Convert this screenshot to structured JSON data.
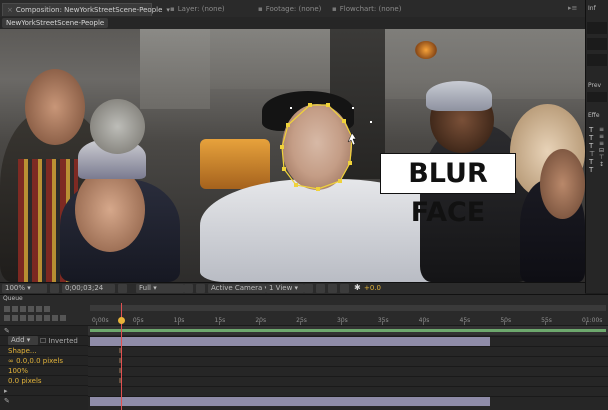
{
  "panels": {
    "composition_tab": "Composition: NewYorkStreetScene-People",
    "layer_tab": "Layer: (none)",
    "footage_tab": "Footage: (none)",
    "flowchart_tab": "Flowchart: (none)",
    "right_tab": "Inf"
  },
  "composition": {
    "name_chip": "NewYorkStreetScene-People"
  },
  "overlay": {
    "label": "BLUR FACE"
  },
  "viewer_toolbar": {
    "zoom": "100%",
    "timecode": "0;00;03;24",
    "resolution": "Full",
    "view": "Active Camera",
    "views": "1 View",
    "exposure": "+0.0"
  },
  "right_panel": {
    "preview_label": "Prev",
    "effects_label": "Effe"
  },
  "timeline": {
    "panel_label": "Queue",
    "ruler_ticks": [
      "0:00s",
      "05s",
      "10s",
      "15s",
      "20s",
      "25s",
      "30s",
      "35s",
      "40s",
      "45s",
      "50s",
      "55s",
      "01:00s"
    ],
    "rows": {
      "mode": "Add",
      "inverted": "Inverted",
      "mask_shape": "Shape...",
      "mask_feather": "0.0,0.0 pixels",
      "mask_opacity": "100%",
      "mask_expansion": "0.0 pixels"
    }
  },
  "colors": {
    "accent_yellow": "#e2b33a",
    "playhead_red": "#e05050",
    "layer_bar": "#8f8ca8"
  }
}
